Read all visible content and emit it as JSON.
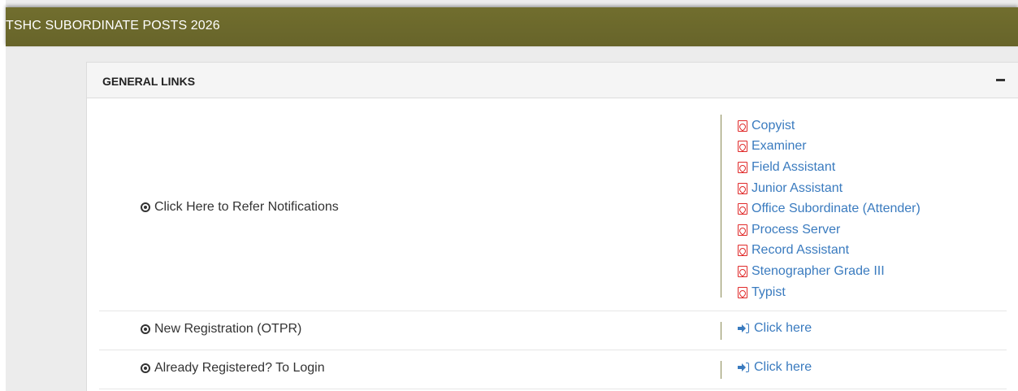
{
  "header": {
    "title": "TSHC SUBORDINATE POSTS 2026"
  },
  "panel": {
    "title": "GENERAL LINKS",
    "collapse_symbol": "−"
  },
  "rows": [
    {
      "label": "Click Here to Refer Notifications",
      "links": [
        "Copyist",
        "Examiner",
        "Field Assistant",
        "Junior Assistant",
        "Office Subordinate (Attender)",
        "Process Server",
        "Record Assistant",
        "Stenographer Grade III",
        "Typist"
      ]
    },
    {
      "label": "New Registration (OTPR)",
      "link": "Click here"
    },
    {
      "label": "Already Registered? To Login",
      "link": "Click here"
    }
  ],
  "colors": {
    "header_bg": "#6c692c",
    "link": "#3a7bbf",
    "pdf_icon": "#e02a2a"
  },
  "icons": {
    "row_bullet": "dot-circle-icon",
    "notification_link": "file-pdf-icon",
    "action_link": "sign-in-icon"
  }
}
